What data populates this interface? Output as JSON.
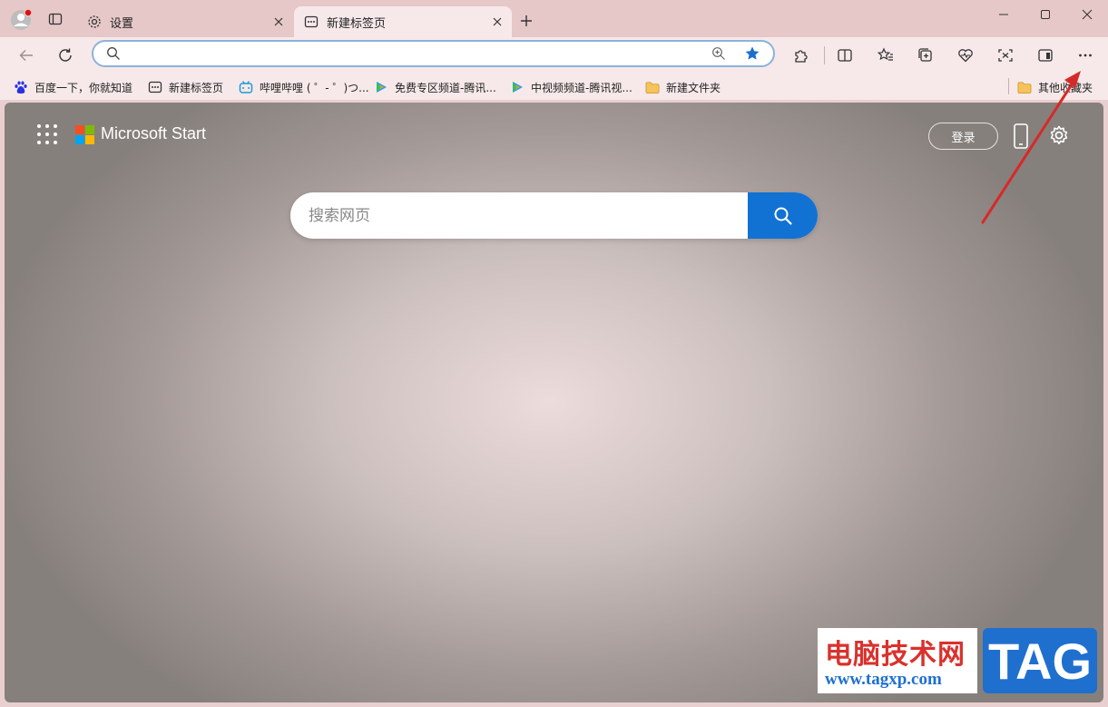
{
  "tabs": [
    {
      "label": "设置",
      "icon": "gear-icon"
    },
    {
      "label": "新建标签页",
      "icon": "newtab-icon"
    }
  ],
  "address_bar": {
    "value": "",
    "placeholder": ""
  },
  "bookmarks": [
    {
      "label": "百度一下，你就知道",
      "icon": "baidu-icon"
    },
    {
      "label": "新建标签页",
      "icon": "newtab-icon"
    },
    {
      "label": "哔哩哔哩 ( ゜- ゜)つ...",
      "icon": "bilibili-icon"
    },
    {
      "label": "免费专区频道-腾讯...",
      "icon": "tencent-video-icon"
    },
    {
      "label": "中视频频道-腾讯视...",
      "icon": "tencent-video-icon"
    },
    {
      "label": "新建文件夹",
      "icon": "folder-icon"
    }
  ],
  "other_favorites": "其他收藏夹",
  "start_page": {
    "brand": "Microsoft Start",
    "login_label": "登录",
    "search_placeholder": "搜索网页"
  },
  "watermark": {
    "cn_text": "电脑技术网",
    "url": "www.tagxp.com",
    "tag": "TAG"
  },
  "colors": {
    "accent": "#1172d4",
    "arrow": "#d62a2a",
    "frame": "#e6c8c8"
  }
}
